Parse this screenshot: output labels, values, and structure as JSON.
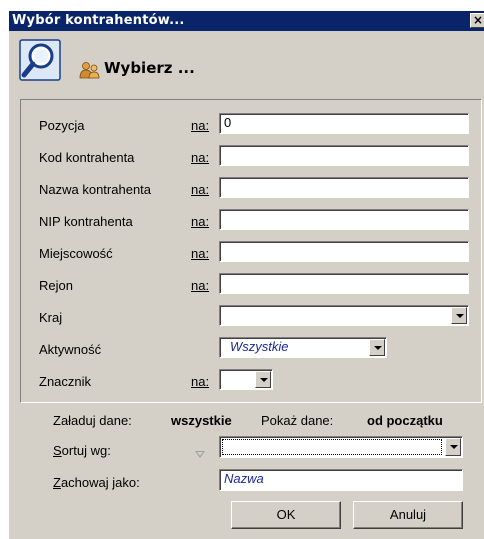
{
  "window": {
    "title": "Wybór kontrahentów...",
    "close_label": "×",
    "header_title": "Wybierz ..."
  },
  "filters": {
    "na_label": "na:",
    "pozycja": {
      "label": "Pozycja",
      "value": "0"
    },
    "kod": {
      "label": "Kod kontrahenta",
      "value": ""
    },
    "nazwa": {
      "label": "Nazwa kontrahenta",
      "value": ""
    },
    "nip": {
      "label": "NIP kontrahenta",
      "value": ""
    },
    "miejscowosc": {
      "label": "Miejscowość",
      "value": ""
    },
    "rejon": {
      "label": "Rejon",
      "value": ""
    },
    "kraj": {
      "label": "Kraj",
      "value": ""
    },
    "aktywnosc": {
      "label": "Aktywność",
      "value": "Wszystkie"
    },
    "znacznik": {
      "label": "Znacznik",
      "value": ""
    }
  },
  "options": {
    "zaladuj_label": "Załaduj dane:",
    "zaladuj_value": "wszystkie",
    "pokaz_label": "Pokaż dane:",
    "pokaz_value": "od początku",
    "sortuj_label": "Sortuj wg:",
    "sortuj_value": "",
    "zachowaj_label": "Zachowaj jako:",
    "zachowaj_value": "Nazwa"
  },
  "buttons": {
    "ok": "OK",
    "cancel": "Anuluj"
  }
}
